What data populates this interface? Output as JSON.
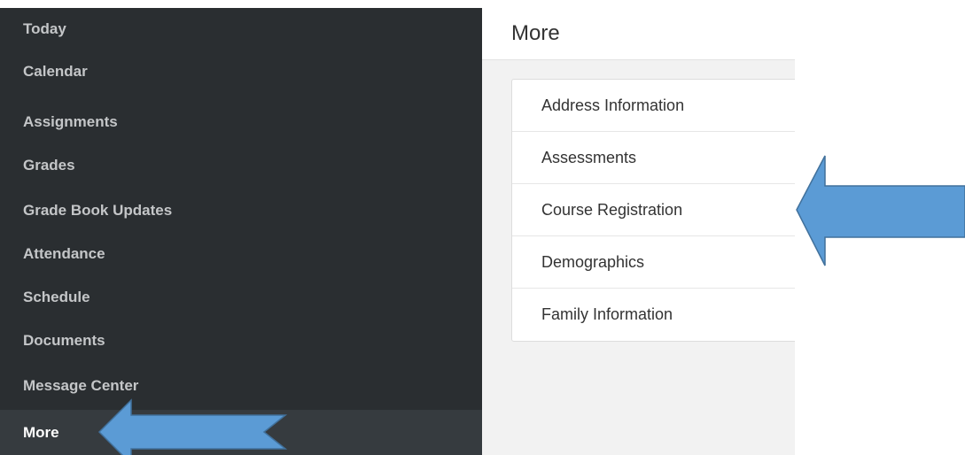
{
  "sidebar": {
    "items": [
      {
        "label": "Today"
      },
      {
        "label": "Calendar"
      },
      {
        "label": "Assignments"
      },
      {
        "label": "Grades"
      },
      {
        "label": "Grade Book Updates"
      },
      {
        "label": "Attendance"
      },
      {
        "label": "Schedule"
      },
      {
        "label": "Documents"
      },
      {
        "label": "Message Center"
      },
      {
        "label": "More",
        "active": true
      }
    ]
  },
  "main": {
    "title": "More",
    "menu": [
      {
        "label": "Address Information"
      },
      {
        "label": "Assessments"
      },
      {
        "label": "Course Registration"
      },
      {
        "label": "Demographics"
      },
      {
        "label": "Family Information"
      }
    ]
  },
  "annotations": {
    "arrow_color": "#5b9bd5",
    "arrow_stroke": "#41719c"
  },
  "colors": {
    "sidebar_bg": "#2a2e31",
    "sidebar_active_bg": "#363b3f",
    "content_bg": "#f2f2f2"
  }
}
